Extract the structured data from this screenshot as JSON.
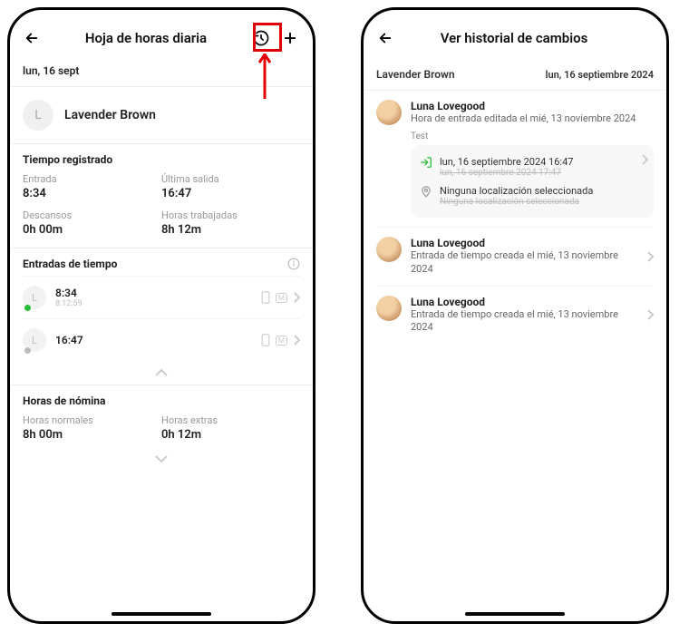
{
  "phone1": {
    "title": "Hoja de horas diaria",
    "date": "lun, 16 sept",
    "user_initial": "L",
    "user_name": "Lavender Brown",
    "section_recorded": "Tiempo registrado",
    "recorded": {
      "entry_label": "Entrada",
      "entry_value": "8:34",
      "last_exit_label": "Última salida",
      "last_exit_value": "16:47",
      "breaks_label": "Descansos",
      "breaks_value": "0h 00m",
      "worked_label": "Horas trabajadas",
      "worked_value": "8h 12m"
    },
    "section_entries": "Entradas de tiempo",
    "entries": [
      {
        "initial": "L",
        "time": "8:34",
        "sub": "8:12:59",
        "m": "M",
        "green": true
      },
      {
        "initial": "L",
        "time": "16:47",
        "sub": "",
        "m": "M",
        "green": false
      }
    ],
    "section_payroll": "Horas de nómina",
    "payroll": {
      "normal_label": "Horas normales",
      "normal_value": "8h 00m",
      "extra_label": "Horas extras",
      "extra_value": "0h 12m"
    }
  },
  "phone2": {
    "title": "Ver historial de cambios",
    "name": "Lavender Brown",
    "date": "lun, 16 septiembre 2024",
    "test_label": "Test",
    "change": {
      "new_time": "lun, 16 septiembre 2024 16:47",
      "old_time": "lun, 16 septiembre 2024 17:47",
      "new_loc": "Ninguna localización seleccionada",
      "old_loc": "Ninguna localización seleccionada"
    },
    "items": [
      {
        "user": "Luna Lovegood",
        "desc": "Hora de entrada editada el mié, 13 noviembre 2024"
      },
      {
        "user": "Luna Lovegood",
        "desc": "Entrada de tiempo creada el mié, 13 noviembre 2024"
      },
      {
        "user": "Luna Lovegood",
        "desc": "Entrada de tiempo creada el mié, 13 noviembre 2024"
      }
    ]
  }
}
